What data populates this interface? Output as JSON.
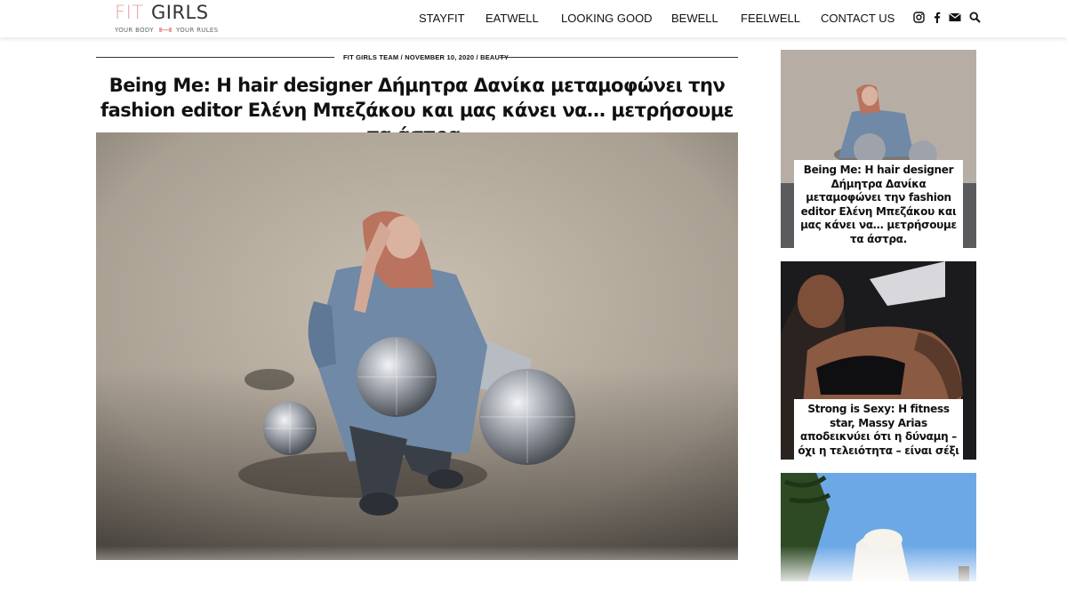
{
  "logo": {
    "fit": "FIT",
    "girls": "GIRLS",
    "tagline_left": "YOUR BODY",
    "tagline_right": "YOUR RULES"
  },
  "nav": {
    "items": [
      "STAYFIT",
      "EATWELL",
      "LOOKING GOOD",
      "BEWELL",
      "FEELWELL",
      "CONTACT US"
    ]
  },
  "social": {
    "icons": [
      "instagram-icon",
      "facebook-icon",
      "mail-icon",
      "search-icon"
    ]
  },
  "article": {
    "meta": "FIT GIRLS TEAM / NOVEMBER 10, 2020 / BEAUTY",
    "title": "Being Me: Η hair designer Δήμητρα Δανίκα μεταμοφώνει την fashion editor Ελένη Μπεζάκου και μας κάνει να… μετρήσουμε τα άστρα."
  },
  "sidebar": {
    "cards": [
      {
        "title": "Being Me: Η hair designer Δήμητρα Δανίκα μεταμοφώνει την fashion editor Ελένη Μπεζάκου και μας κάνει να… μετρήσουμε τα άστρα."
      },
      {
        "title": "Strong is Sexy: Η fitness star, Massy Arias αποδεικνύει ότι η δύναμη – όχι η τελειότητα – είναι σέξι"
      },
      {
        "title": ""
      }
    ]
  },
  "colors": {
    "logo_accent": "#e8a39b",
    "text": "#111111"
  }
}
